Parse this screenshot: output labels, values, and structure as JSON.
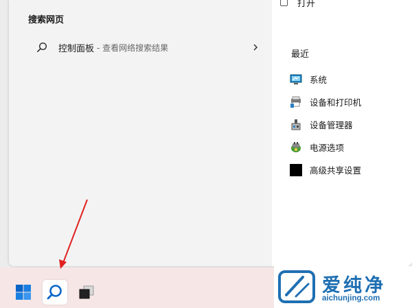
{
  "search_web": {
    "section_title": "搜索网页",
    "result": {
      "query": "控制面板",
      "suffix": "- 查看网络搜索结果"
    }
  },
  "details": {
    "open_label": "打开",
    "recent_title": "最近",
    "recent_items": [
      {
        "label": "系统",
        "icon": "system-icon"
      },
      {
        "label": "设备和打印机",
        "icon": "devices-printers-icon"
      },
      {
        "label": "设备管理器",
        "icon": "device-manager-icon"
      },
      {
        "label": "电源选项",
        "icon": "power-options-icon"
      },
      {
        "label": "高级共享设置",
        "icon": "advanced-sharing-icon"
      }
    ]
  },
  "taskbar": {
    "buttons": [
      "start-button",
      "search-button",
      "task-view-button"
    ]
  },
  "watermark": {
    "brand_cn": "爱纯净",
    "brand_en": "aichunjing.com"
  },
  "colors": {
    "accent": "#0a64c8",
    "taskbar_bg": "#f6e6e6",
    "annotation_arrow": "#e02020",
    "watermark_blue": "#1f6fb2"
  }
}
